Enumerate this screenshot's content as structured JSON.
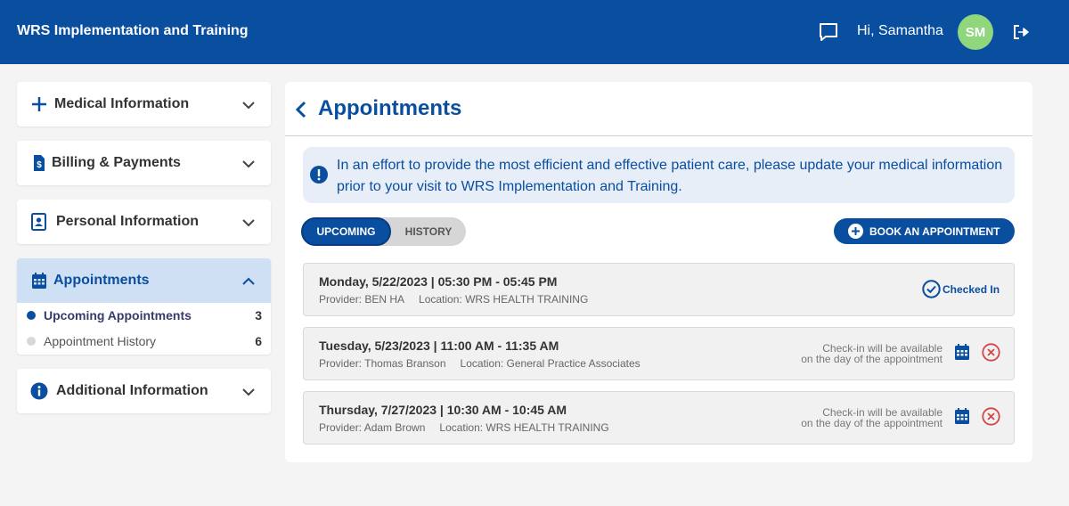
{
  "header": {
    "app_title": "WRS Implementation and Training",
    "greeting": "Hi, Samantha",
    "avatar_initials": "SM",
    "bg_color": "#0a4ea0",
    "avatar_color": "#8fd67d"
  },
  "sidebar": {
    "sections": [
      {
        "label": "Medical Information",
        "icon": "plus-icon",
        "expanded": false
      },
      {
        "label": "Billing & Payments",
        "icon": "invoice-icon",
        "expanded": false
      },
      {
        "label": "Personal Information",
        "icon": "contact-card-icon",
        "expanded": false
      },
      {
        "label": "Appointments",
        "icon": "calendar-icon",
        "expanded": true
      },
      {
        "label": "Additional Information",
        "icon": "info-icon",
        "expanded": false
      }
    ],
    "appointments_items": [
      {
        "label": "Upcoming Appointments",
        "count": "3",
        "active": true
      },
      {
        "label": "Appointment History",
        "count": "6",
        "active": false
      }
    ]
  },
  "main": {
    "title": "Appointments",
    "notice": "In an effort to provide the most efficient and effective patient care, please update your medical information prior to your visit to WRS Implementation and Training.",
    "tabs": [
      {
        "label": "UPCOMING",
        "selected": true
      },
      {
        "label": "HISTORY",
        "selected": false
      }
    ],
    "book_button": "BOOK AN APPOINTMENT",
    "appointments": [
      {
        "when": "Monday, 5/22/2023 | 05:30 PM - 05:45 PM",
        "provider": "Provider: BEN HA",
        "location": "Location: WRS HEALTH TRAINING",
        "status": "Checked In"
      },
      {
        "when": "Tuesday, 5/23/2023 | 11:00 AM - 11:35 AM",
        "provider": "Provider: Thomas Branson",
        "location": "Location: General Practice Associates",
        "checkin_line1": "Check-in will be available",
        "checkin_line2": "on the day of the appointment"
      },
      {
        "when": "Thursday, 7/27/2023 | 10:30 AM - 10:45 AM",
        "provider": "Provider: Adam Brown",
        "location": "Location: WRS HEALTH TRAINING",
        "checkin_line1": "Check-in will be available",
        "checkin_line2": "on the day of the appointment"
      }
    ]
  },
  "colors": {
    "primary": "#0a4ea0",
    "cancel_red": "#d64545",
    "active_nav_bg": "#d0e0f4"
  }
}
